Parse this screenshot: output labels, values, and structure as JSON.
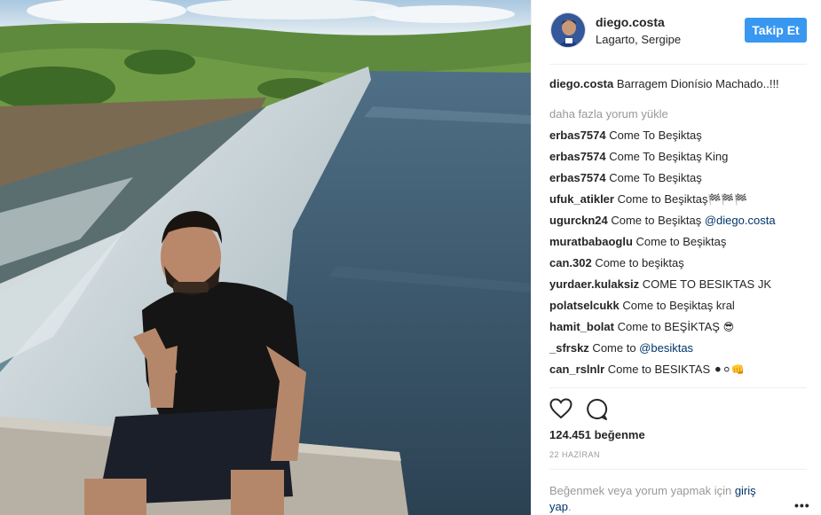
{
  "post": {
    "username": "diego.costa",
    "location": "Lagarto, Sergipe",
    "follow_label": "Takip Et",
    "caption_user": "diego.costa",
    "caption_text": " Barragem Dionísio Machado..!!!",
    "load_more": "daha fazla yorum yükle",
    "likes": "124.451 beğenme",
    "date": "22 HAZİRAN",
    "login_prefix": "Beğenmek veya yorum yapmak için ",
    "login_link": "giriş yap",
    "login_suffix": ".",
    "more_dots": "•••"
  },
  "comments": [
    {
      "user": "erbas7574",
      "text": " Come To Beşiktaş",
      "mention": "",
      "emoji": ""
    },
    {
      "user": "erbas7574",
      "text": " Come To Beşiktaş King",
      "mention": "",
      "emoji": ""
    },
    {
      "user": "erbas7574",
      "text": " Come To Beşiktaş",
      "mention": "",
      "emoji": ""
    },
    {
      "user": "ufuk_atikler",
      "text": " Come to Beşiktaş",
      "mention": "",
      "emoji": "🏁🏁🏁"
    },
    {
      "user": "ugurckn24",
      "text": " Come to Beşiktaş ",
      "mention": "@diego.costa",
      "emoji": ""
    },
    {
      "user": "muratbabaoglu",
      "text": " Come to Beşiktaş",
      "mention": "",
      "emoji": ""
    },
    {
      "user": "can.302",
      "text": " Come to beşiktaş",
      "mention": "",
      "emoji": ""
    },
    {
      "user": "yurdaer.kulaksiz",
      "text": " COME TO BESIKTAS JK",
      "mention": "",
      "emoji": ""
    },
    {
      "user": "polatselcukk",
      "text": " Come to Beşiktaş kral",
      "mention": "",
      "emoji": ""
    },
    {
      "user": "hamit_bolat",
      "text": " Come to BEŞİKTAŞ ",
      "mention": "",
      "emoji": "😎"
    },
    {
      "user": "_sfrskz",
      "text": " Come to ",
      "mention": "@besiktas",
      "emoji": ""
    },
    {
      "user": "can_rslnlr",
      "text": " Come to BESIKTAS ",
      "mention": "",
      "emoji": "⚫⚪👊"
    }
  ],
  "icons": {
    "heart": "heart-icon",
    "comment": "comment-bubble-icon",
    "avatar": "avatar"
  },
  "colors": {
    "accent": "#3897f0",
    "link": "#003569",
    "muted": "#999999",
    "text": "#262626",
    "divider": "#efefef"
  }
}
